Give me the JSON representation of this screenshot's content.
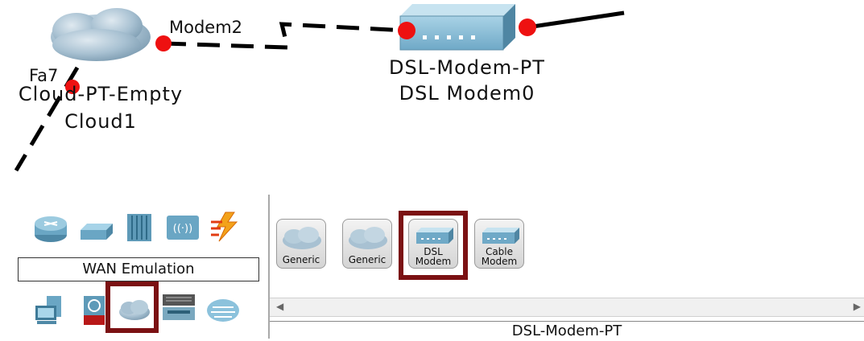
{
  "topology": {
    "cloud": {
      "label_line1": "Cloud-PT-Empty",
      "label_line2": "Cloud1",
      "port_fa": "Fa7",
      "port_modem": "Modem2"
    },
    "dsl_modem": {
      "label_line1": "DSL-Modem-PT",
      "label_line2": "DSL Modem0"
    },
    "link_dot_color": "#ee1111",
    "link_color": "#000000"
  },
  "device_panel": {
    "category_label": "WAN Emulation",
    "category_icons": [
      "router-icon",
      "switch-icon",
      "hub-icon",
      "wireless-icon",
      "connections-icon",
      "end-devices-icon",
      "security-icon",
      "wan-emulation-icon",
      "custom-devices-icon",
      "multiuser-icon"
    ],
    "device_tiles": [
      {
        "name": "generic-cloud-1",
        "line1": "Generic",
        "line2": ""
      },
      {
        "name": "generic-cloud-2",
        "line1": "Generic",
        "line2": ""
      },
      {
        "name": "dsl-modem",
        "line1": "DSL",
        "line2": "Modem"
      },
      {
        "name": "cable-modem",
        "line1": "Cable",
        "line2": "Modem"
      }
    ],
    "selected_model": "DSL-Modem-PT",
    "highlight_color": "#7b1113"
  }
}
